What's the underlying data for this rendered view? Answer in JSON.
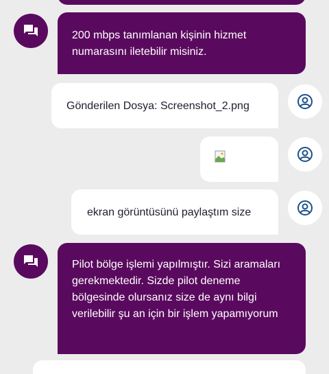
{
  "colors": {
    "background": "#ececec",
    "agent_bubble": "#5a0a5e",
    "user_bubble": "#ffffff",
    "user_icon": "#1b4f8a"
  },
  "messages": [
    {
      "sender": "agent",
      "text": "200 mbps tanımlanan kişinin hizmet numarasını iletebilir misiniz."
    },
    {
      "sender": "user",
      "text": "Gönderilen Dosya: Screenshot_2.png"
    },
    {
      "sender": "user",
      "type": "image",
      "icon": "broken-image-icon"
    },
    {
      "sender": "user",
      "text": "ekran görüntüsünü paylaştım size"
    },
    {
      "sender": "agent",
      "text": "Pilot bölge işlemi yapılmıştır. Sizi aramaları gerekmektedir. Sizde pilot deneme bölgesinde olursanız size de aynı bilgi verilebilir şu an için bir işlem yapamıyorum"
    }
  ]
}
